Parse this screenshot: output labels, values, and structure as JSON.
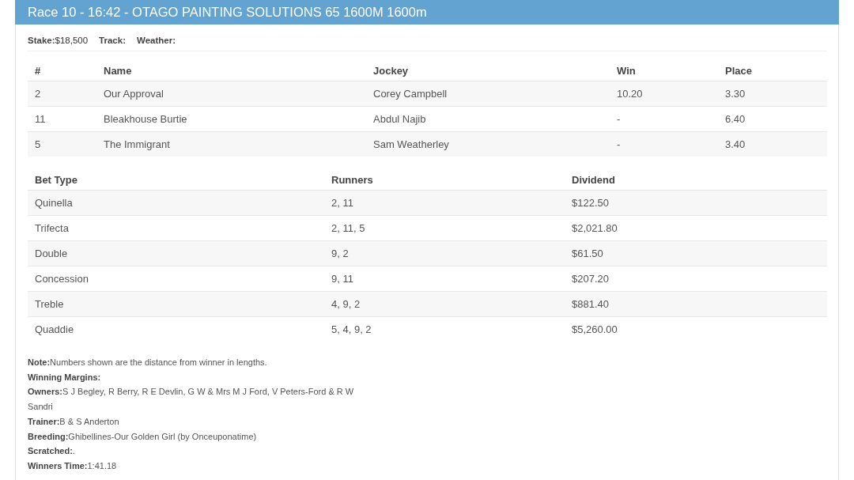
{
  "title": "Race 10 - 16:42 - OTAGO PAINTING SOLUTIONS 65 1600M 1600m",
  "race_info": [
    {
      "label": "Stake:",
      "value": "$18,500"
    },
    {
      "label": "Track:"
    },
    {
      "label": "Weather:"
    }
  ],
  "results": {
    "columns": [
      "#",
      "Name",
      "Jockey",
      "Win",
      "Place"
    ],
    "rows": [
      {
        "number": "2",
        "name": "Our Approval",
        "jockey": "Corey Campbell",
        "win": "10.20",
        "place": "3.30"
      },
      {
        "number": "11",
        "name": "Bleakhouse Burtie",
        "jockey": "Abdul Najib",
        "win": "-",
        "place": "6.40"
      },
      {
        "number": "5",
        "name": "The Immigrant",
        "jockey": "Sam Weatherley",
        "win": "-",
        "place": "3.40"
      }
    ]
  },
  "dividends": {
    "columns": [
      "Bet Type",
      "Runners",
      "Dividend"
    ],
    "rows": [
      {
        "bet_type": "Quinella",
        "runners": "2, 11",
        "dividend": "$122.50"
      },
      {
        "bet_type": "Trifecta",
        "runners": "2, 11, 5",
        "dividend": "$2,021.80"
      },
      {
        "bet_type": "Double",
        "runners": "9, 2",
        "dividend": "$61.50"
      },
      {
        "bet_type": "Concession",
        "runners": "9, 11",
        "dividend": "$207.20"
      },
      {
        "bet_type": "Treble",
        "runners": "4, 9, 2",
        "dividend": "$881.40"
      },
      {
        "bet_type": "Quaddie",
        "runners": "5, 4, 9, 2",
        "dividend": "$5,260.00"
      }
    ]
  },
  "notes": [
    {
      "label": "Note:",
      "value": "Numbers shown are the distance from winner in lengths."
    },
    {
      "label": "Winning Margins:"
    },
    {
      "label": "Owners:",
      "value": "S J Begley, R Berry, R E Devlin, G W & Mrs M J Ford, V Peters-Ford & R W Sandri"
    },
    {
      "label": "Trainer:",
      "value": "B & S Anderton"
    },
    {
      "label": "Breeding:",
      "value": "Ghibellines-Our Golden Girl (by Onceuponatime)"
    },
    {
      "label": "Scratched:",
      "value": "."
    },
    {
      "label": "Winners Time:",
      "value": "1:41.18"
    }
  ]
}
